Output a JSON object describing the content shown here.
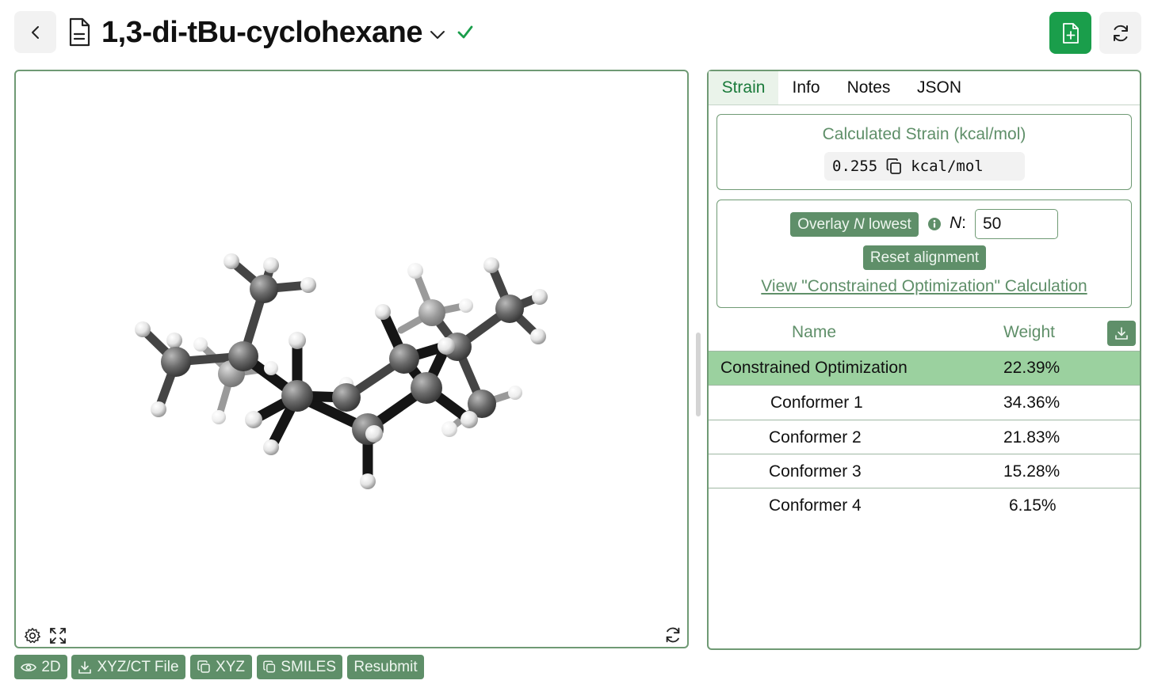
{
  "header": {
    "title": "1,3-di-tBu-cyclohexane",
    "accent": "#1a9e4b"
  },
  "viewer": {
    "toolbar": [
      {
        "label": "2D",
        "icon": "eye-icon"
      },
      {
        "label": "XYZ/CT File",
        "icon": "download-icon"
      },
      {
        "label": "XYZ",
        "icon": "copy-icon"
      },
      {
        "label": "SMILES",
        "icon": "copy-icon"
      },
      {
        "label": "Resubmit",
        "icon": ""
      }
    ]
  },
  "panel": {
    "tabs": [
      "Strain",
      "Info",
      "Notes",
      "JSON"
    ],
    "active_tab": "Strain",
    "strain": {
      "title": "Calculated Strain (kcal/mol)",
      "value": "0.255",
      "unit": "kcal/mol"
    },
    "overlay": {
      "button_prefix": "Overlay ",
      "button_n": "N",
      "button_suffix": " lowest",
      "n_label": "N",
      "n_colon": ":",
      "n_value": "50",
      "reset_label": "Reset alignment",
      "link_label": "View \"Constrained Optimization\" Calculation"
    },
    "table": {
      "headers": {
        "name": "Name",
        "weight": "Weight"
      },
      "rows": [
        {
          "name": "Constrained Optimization",
          "weight": "22.39%",
          "highlighted": true
        },
        {
          "name": "Conformer 1",
          "weight": "34.36%",
          "highlighted": false
        },
        {
          "name": "Conformer 2",
          "weight": "21.83%",
          "highlighted": false
        },
        {
          "name": "Conformer 3",
          "weight": "15.28%",
          "highlighted": false
        },
        {
          "name": "Conformer 4",
          "weight": "6.15%",
          "highlighted": false
        }
      ]
    }
  },
  "colors": {
    "button_green": "#5f8f69",
    "border_green": "#6f9a74",
    "highlight_row": "#9bd19f",
    "tab_active_text": "#1a7a3a"
  }
}
